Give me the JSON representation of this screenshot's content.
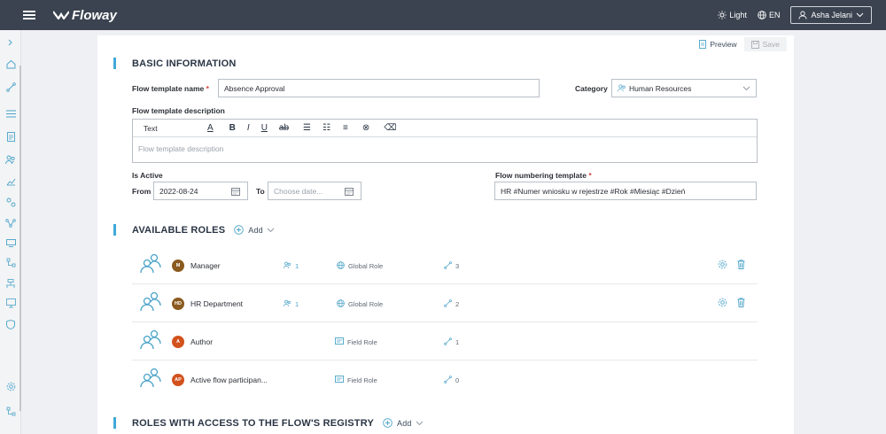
{
  "app": {
    "name": "Floway"
  },
  "topbar": {
    "theme": "Light",
    "language": "EN",
    "user": "Asha Jelani"
  },
  "tabs": {
    "preview": "Preview",
    "save": "Save"
  },
  "basic": {
    "title": "BASIC INFORMATION",
    "name_label": "Flow template name",
    "name_value": "Absence Approval",
    "category_label": "Category",
    "category_value": "Human Resources",
    "desc_label": "Flow template description",
    "desc_format": "Text",
    "desc_placeholder": "Flow template description",
    "active_label": "Is Active",
    "from_label": "From",
    "from_value": "2022-08-24",
    "to_label": "To",
    "to_placeholder": "Choose date...",
    "numbering_label": "Flow numbering template",
    "numbering_value": "HR #Numer wniosku w rejestrze #Rok #Miesiąc #Dzień"
  },
  "roles": {
    "title": "AVAILABLE ROLES",
    "add": "Add",
    "items": [
      {
        "initials": "M",
        "name": "Manager",
        "users": "1",
        "type": "Global Role",
        "flows": "3",
        "color": "#8a5a1e",
        "actions": true
      },
      {
        "initials": "HD",
        "name": "HR Department",
        "users": "1",
        "type": "Global Role",
        "flows": "2",
        "color": "#8a5a1e",
        "actions": true
      },
      {
        "initials": "A",
        "name": "Author",
        "users": "",
        "type": "Field Role",
        "flows": "1",
        "color": "#d2521e",
        "actions": false
      },
      {
        "initials": "AP",
        "name": "Active flow participan...",
        "users": "",
        "type": "Field Role",
        "flows": "0",
        "color": "#d2521e",
        "actions": false
      }
    ]
  },
  "registry": {
    "title": "ROLES WITH ACCESS TO THE FLOW'S REGISTRY",
    "add": "Add"
  },
  "colors": {
    "accent": "#3fa8d8",
    "topbar": "#3b4350"
  }
}
